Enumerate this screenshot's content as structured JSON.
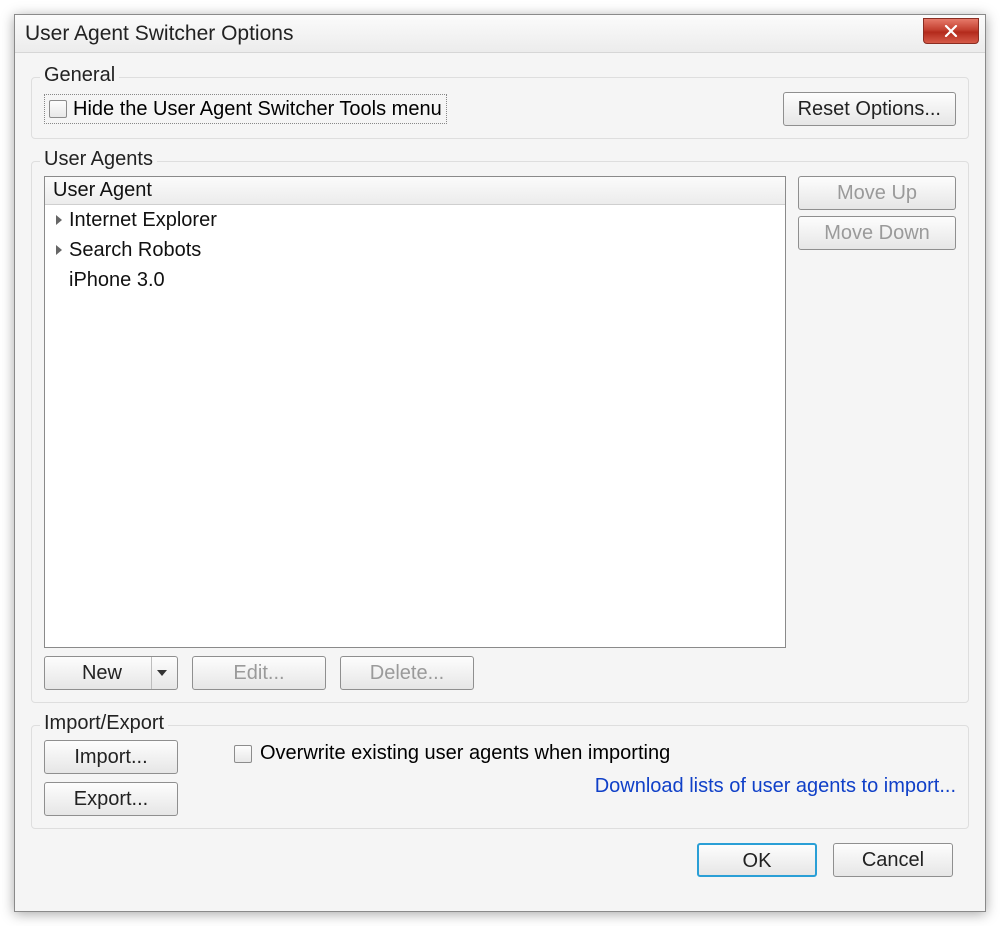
{
  "dialog": {
    "title": "User Agent Switcher Options"
  },
  "general": {
    "group_label": "General",
    "hide_tools_menu_label": "Hide the User Agent Switcher Tools menu",
    "hide_tools_menu_checked": false,
    "reset_label": "Reset Options..."
  },
  "user_agents": {
    "group_label": "User Agents",
    "header": "User Agent",
    "items": [
      {
        "label": "Internet Explorer",
        "expandable": true
      },
      {
        "label": "Search Robots",
        "expandable": true
      },
      {
        "label": "iPhone 3.0",
        "expandable": false
      }
    ],
    "move_up": "Move Up",
    "move_down": "Move Down",
    "new": "New",
    "edit": "Edit...",
    "delete": "Delete..."
  },
  "import_export": {
    "group_label": "Import/Export",
    "import": "Import...",
    "export": "Export...",
    "overwrite_label": "Overwrite existing user agents when importing",
    "overwrite_checked": false,
    "download_link": "Download lists of user agents to import..."
  },
  "footer": {
    "ok": "OK",
    "cancel": "Cancel"
  }
}
